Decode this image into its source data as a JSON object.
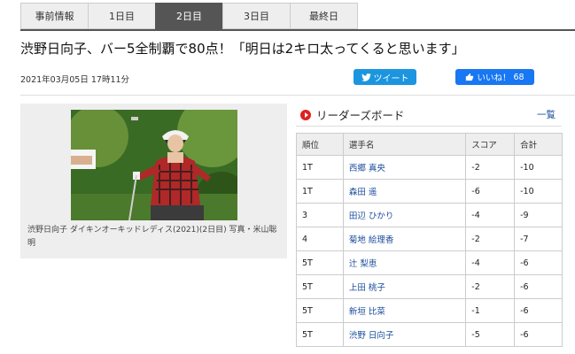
{
  "tabs": [
    {
      "label": "事前情報",
      "active": false
    },
    {
      "label": "1日目",
      "active": false
    },
    {
      "label": "2日目",
      "active": true
    },
    {
      "label": "3日目",
      "active": false
    },
    {
      "label": "最終日",
      "active": false
    }
  ],
  "article": {
    "headline": "渋野日向子、バー5全制覇で80点！「明日は2キロ太ってくると思います」",
    "date": "2021年03月05日 17時11分",
    "caption": "渋野日向子 ダイキンオーキッドレディス(2021)(2日目) 写真・米山聡明"
  },
  "share": {
    "tweet_label": "ツイート",
    "like_label": "いいね！",
    "like_count": "68"
  },
  "leaderboard": {
    "title": "リーダーズボード",
    "more_label": "一覧",
    "columns": [
      "順位",
      "選手名",
      "スコア",
      "合計"
    ],
    "rows": [
      {
        "rank": "1T",
        "name": "西郷 真央",
        "score": "-2",
        "total": "-10"
      },
      {
        "rank": "1T",
        "name": "森田 遥",
        "score": "-6",
        "total": "-10"
      },
      {
        "rank": "3",
        "name": "田辺 ひかり",
        "score": "-4",
        "total": "-9"
      },
      {
        "rank": "4",
        "name": "菊地 絵理香",
        "score": "-2",
        "total": "-7"
      },
      {
        "rank": "5T",
        "name": "辻 梨恵",
        "score": "-4",
        "total": "-6"
      },
      {
        "rank": "5T",
        "name": "上田 桃子",
        "score": "-2",
        "total": "-6"
      },
      {
        "rank": "5T",
        "name": "新垣 比菜",
        "score": "-1",
        "total": "-6"
      },
      {
        "rank": "5T",
        "name": "渋野 日向子",
        "score": "-5",
        "total": "-6"
      }
    ]
  },
  "colors": {
    "tweet": "#1b95e0",
    "like": "#1877f2",
    "active_tab": "#555555",
    "link": "#1a4c9c",
    "live_dot": "#e02020"
  }
}
